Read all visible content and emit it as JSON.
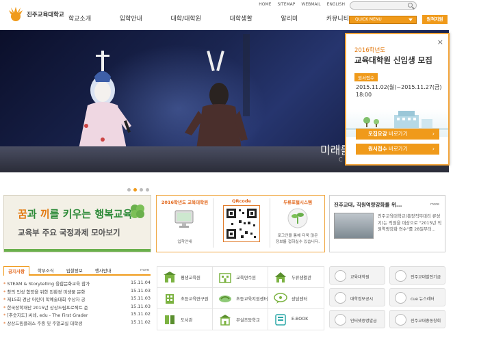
{
  "header": {
    "logo_text": "진주교육대학교",
    "util_links": [
      "HOME",
      "SITEMAP",
      "WEBMAIL",
      "ENGLISH"
    ],
    "search_placeholder": "",
    "gnb": [
      "학교소개",
      "입학안내",
      "대학/대학원",
      "대학생활",
      "알리미",
      "커뮤니티"
    ],
    "quick_menu": "QUICK MENU",
    "apply_button": "원격지원"
  },
  "hero": {
    "title": "미래를",
    "subtitle": "C"
  },
  "popup": {
    "year": "2016학년도",
    "title": "교육대학원 신입생 모집",
    "badge": "원서접수",
    "dates": "2015.11.02(월)~2015.11.27(금)",
    "time": "18:00",
    "btn1_bold": "모집요강",
    "btn1_rest": " 바로가기",
    "btn2_bold": "원서접수",
    "btn2_rest": " 바로가기",
    "go": "›",
    "close": "×"
  },
  "banner_left": {
    "l1_a": "꿈",
    "l1_b": "과 ",
    "l1_c": "끼",
    "l1_d": "를 키우는 ",
    "l1_e": "행복교육",
    "l2": "교육부 주요 국정과제 모아보기"
  },
  "mid_box": {
    "col1_head": "2016학년도 교육대학원",
    "col1_cap": "입학안내",
    "col2_head": "QRcode",
    "col3_head": "두류포털시스템",
    "col3_cap1": "로그인을 통해 더욱 많은",
    "col3_cap2": "정보를 접하실수 있습니다."
  },
  "news": {
    "title": "진주교대, 직원역량강화를 위...",
    "more": "more",
    "body": "진주교육대학교(총장직무대리 류성기)는 직원을 대상으로 \"2015년 직원역량강화 연수\"를 28일부터..."
  },
  "notices": {
    "tabs": [
      "공지사항",
      "학부소식",
      "입찰정보",
      "행사안내"
    ],
    "more": "more",
    "items": [
      {
        "title": "STEAM & Storytelling 융합문화교육 참가",
        "date": "15.11.04"
      },
      {
        "title": "창의 인성 함양을 위한 친환경 미생물 문화",
        "date": "15.11.03"
      },
      {
        "title": "제15회 경남 어린이 학예술대회 수상자 공",
        "date": "15.11.03"
      },
      {
        "title": "한국장학재단 2015년 상상드림프로젝트 준",
        "date": "15.11.03"
      },
      {
        "title": "[추숫지도] 씨네, edu - The First Grader",
        "date": "15.11.02"
      },
      {
        "title": "상상드림클래스 주중 및 주말교실 대학생",
        "date": "15.11.02"
      }
    ]
  },
  "quick_links": [
    {
      "label": "평생교육원",
      "icon": "building-icon"
    },
    {
      "label": "교육연수원",
      "icon": "school-icon"
    },
    {
      "label": "두류생활관",
      "icon": "house-icon"
    },
    {
      "label": "초등교육연구원",
      "icon": "building2-icon"
    },
    {
      "label": "초등교육지원센터",
      "icon": "handshake-icon"
    },
    {
      "label": "상담센터",
      "icon": "chat-icon"
    },
    {
      "label": "도서관",
      "icon": "book-icon"
    },
    {
      "label": "부설초등학교",
      "icon": "school2-icon"
    },
    {
      "label": "E-BOOK",
      "icon": "ebook-icon"
    }
  ],
  "right_buttons": [
    {
      "label": "교육대학원",
      "icon": "circle-icon"
    },
    {
      "label": "진주교대발전기금",
      "icon": "gear-icon"
    },
    {
      "label": "대학정보공시",
      "icon": "new-icon"
    },
    {
      "label": "cue 뉴스레터",
      "icon": "mail-icon"
    },
    {
      "label": "인터넷증명발급",
      "icon": "doc-icon"
    },
    {
      "label": "진주교대총동창회",
      "icon": "people-icon"
    }
  ],
  "colors": {
    "accent": "#f09a1a",
    "green": "#2f8b3a",
    "hero_dark": "#0b0f2a"
  }
}
